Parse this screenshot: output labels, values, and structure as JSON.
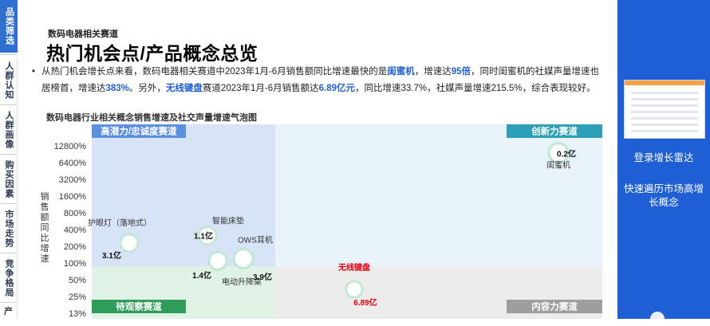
{
  "sidebar": {
    "tabs": [
      {
        "label": "品类筛选",
        "active": true
      },
      {
        "label": "人群认知",
        "active": false
      },
      {
        "label": "人群画像",
        "active": false
      },
      {
        "label": "购买因素",
        "active": false
      },
      {
        "label": "市场走势",
        "active": false
      },
      {
        "label": "竞争格局",
        "active": false
      },
      {
        "label": "产",
        "active": false
      }
    ]
  },
  "header": {
    "category": "数码电器相关赛道",
    "title": "热门机会点/产品概念总览"
  },
  "summary": {
    "p1": "从热门机会增长点来看，数码电器相关赛道中2023年1月-6月销售额同比增速最快的是",
    "h1": "闺蜜机",
    "p2": "，增速达",
    "h2": "95倍",
    "p3": "，同时闺蜜机的社媒声量增速也居榜首，增速达",
    "h3": "383%",
    "p4": "。另外，",
    "h4": "无线键盘",
    "p5": "赛道2023年1月-6月销售额达",
    "h5": "6.89亿元",
    "p6": "，同比增速33.7%，社媒声量增速215.5%，综合表现较好。"
  },
  "chart_data": {
    "type": "scatter",
    "title": "数码电器行业相关概念销售增速及社交声量增速气泡图",
    "ylabel": "销售额同比增速",
    "y_scale": "log2",
    "y_ticks": [
      "12800%",
      "6400%",
      "3200%",
      "1600%",
      "800%",
      "400%",
      "200%",
      "100%",
      "50%",
      "25%",
      "13%"
    ],
    "y_tick_values": [
      12800,
      6400,
      3200,
      1600,
      800,
      400,
      200,
      100,
      50,
      25,
      13
    ],
    "quadrants": {
      "top_left": "高潜力/忠诚度赛道",
      "top_right": "创新力赛道",
      "bottom_left": "待观察赛道",
      "bottom_right": "内容力赛道"
    },
    "colors": {
      "top_left": "#d7e4f8",
      "top_right": "#e9f3fa",
      "bottom_left": "#dff2e5",
      "bottom_right": "#ececec",
      "label_top_left": "#5b8fe0",
      "label_top_right": "#2da0b8",
      "label_bottom_left": "#2e9d5a",
      "label_bottom_right": "#9e9e9e",
      "highlight": "#e60012"
    },
    "points": [
      {
        "name": "闺蜜机",
        "size_label": "0.2亿",
        "y": 9600,
        "highlight": false
      },
      {
        "name": "护眼灯（落地式）",
        "size_label": "3.1亿",
        "y": 230,
        "highlight": false
      },
      {
        "name": "智能床垫",
        "size_label": "1.1亿",
        "y": 310,
        "highlight": false
      },
      {
        "name": "OWS耳机",
        "size_label": "",
        "y": 120,
        "highlight": false
      },
      {
        "name": "电动升降桌",
        "size_label": "1.4亿",
        "y": 110,
        "highlight": false
      },
      {
        "name": "",
        "size_label": "3.9亿",
        "y": 100,
        "highlight": false
      },
      {
        "name": "无线键盘",
        "size_label": "6.89亿",
        "y": 33.7,
        "highlight": true
      }
    ]
  },
  "right_panel": {
    "link1": "登录增长雷达",
    "link2": "快速遍历市场高增长概念"
  }
}
